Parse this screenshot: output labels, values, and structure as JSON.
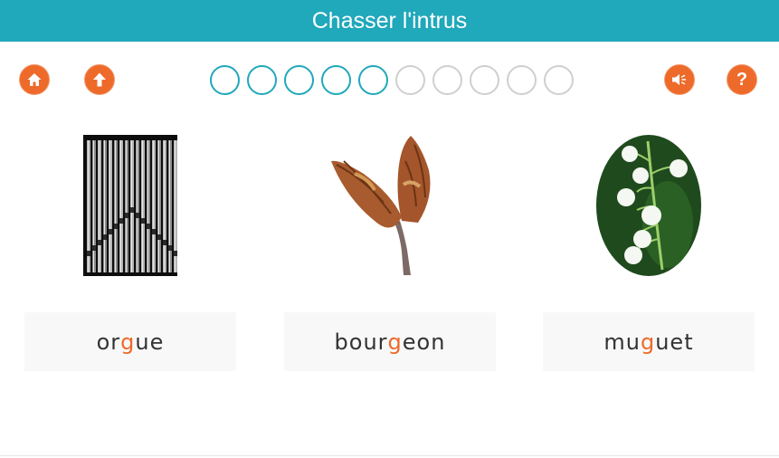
{
  "header": {
    "title": "Chasser l'intrus"
  },
  "toolbar": {
    "home_icon": "home-icon",
    "up_icon": "arrow-up-icon",
    "sound_icon": "speaker-icon",
    "help_icon": "question-icon",
    "help_glyph": "?"
  },
  "progress": {
    "total": 10,
    "completed": 5
  },
  "colors": {
    "accent": "#20a8bb",
    "orange": "#ee6a2a",
    "word_bg": "#f8f8f8"
  },
  "cards": [
    {
      "image": "organ-pipes-image",
      "word": {
        "before": "or",
        "highlight": "g",
        "after": "ue"
      }
    },
    {
      "image": "tree-bud-image",
      "word": {
        "before": "bour",
        "highlight": "g",
        "after": "eon"
      }
    },
    {
      "image": "lily-of-the-valley-image",
      "word": {
        "before": "mu",
        "highlight": "g",
        "after": "uet"
      }
    }
  ]
}
